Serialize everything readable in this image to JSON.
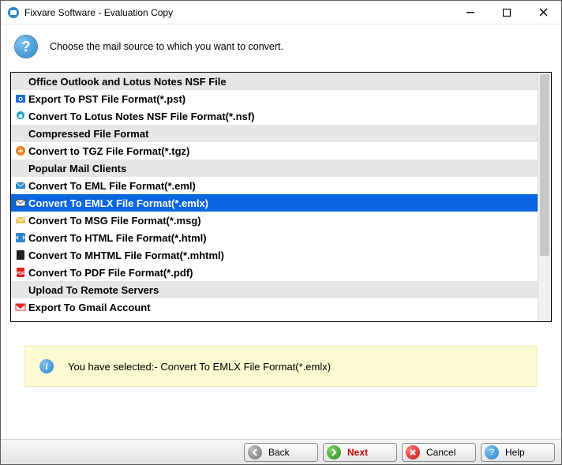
{
  "window": {
    "title": "Fixvare Software - Evaluation Copy"
  },
  "header": {
    "prompt": "Choose the mail source to which you want to convert."
  },
  "list": {
    "rows": [
      {
        "kind": "header",
        "label": "Office Outlook and Lotus Notes NSF File"
      },
      {
        "kind": "item",
        "icon": "pst",
        "label": "Export To PST File Format(*.pst)"
      },
      {
        "kind": "item",
        "icon": "nsf",
        "label": "Convert To Lotus Notes NSF File Format(*.nsf)"
      },
      {
        "kind": "header",
        "label": "Compressed File Format"
      },
      {
        "kind": "item",
        "icon": "tgz",
        "label": "Convert to TGZ File Format(*.tgz)"
      },
      {
        "kind": "header",
        "label": "Popular Mail Clients"
      },
      {
        "kind": "item",
        "icon": "eml",
        "label": "Convert To EML File Format(*.eml)"
      },
      {
        "kind": "item",
        "icon": "emlx",
        "label": "Convert To EMLX File Format(*.emlx)",
        "selected": true
      },
      {
        "kind": "item",
        "icon": "msg",
        "label": "Convert To MSG File Format(*.msg)"
      },
      {
        "kind": "item",
        "icon": "html",
        "label": "Convert To HTML File Format(*.html)"
      },
      {
        "kind": "item",
        "icon": "mhtml",
        "label": "Convert To MHTML File Format(*.mhtml)"
      },
      {
        "kind": "item",
        "icon": "pdf",
        "label": "Convert To PDF File Format(*.pdf)"
      },
      {
        "kind": "header",
        "label": "Upload To Remote Servers"
      },
      {
        "kind": "item",
        "icon": "gmail",
        "label": "Export To Gmail Account"
      }
    ]
  },
  "status": {
    "text": "You have selected:- Convert To EMLX File Format(*.emlx)"
  },
  "footer": {
    "back": "Back",
    "next": "Next",
    "cancel": "Cancel",
    "help": "Help"
  }
}
